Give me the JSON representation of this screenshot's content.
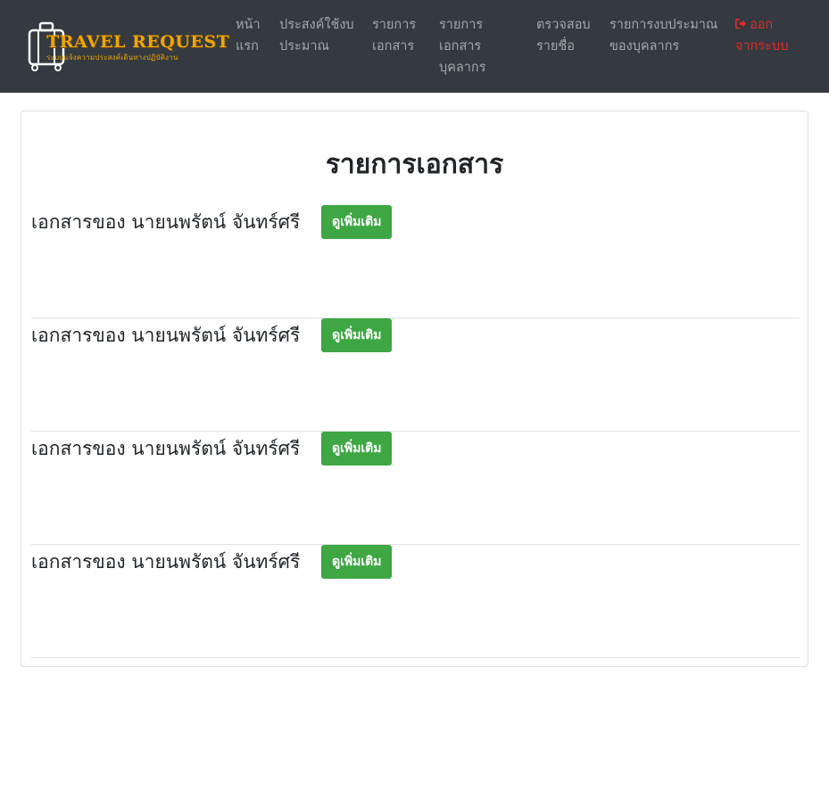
{
  "brand": {
    "title": "TRAVEL REQUEST",
    "subtitle": "ระบบแจ้งความประสงค์เดินทางปฏิบัติงาน",
    "logo_icon": "suitcase-icon",
    "color": "#f0a500"
  },
  "nav": {
    "items": [
      {
        "line1": "หน้า",
        "line2": "แรก",
        "line3": ""
      },
      {
        "line1": "ประสงค์ใช้งบ",
        "line2": "ประมาณ",
        "line3": ""
      },
      {
        "line1": "รายการ",
        "line2": "เอกสาร",
        "line3": ""
      },
      {
        "line1": "รายการ",
        "line2": "เอกสาร",
        "line3": "บุคลากร"
      },
      {
        "line1": "ตรวจสอบ",
        "line2": "รายชื่อ",
        "line3": ""
      },
      {
        "line1": "รายการงบประมาณ",
        "line2": "ของบุคลากร",
        "line3": ""
      }
    ],
    "logout": {
      "line1": "ออก",
      "line2": "จากระบบ",
      "icon": "sign-out-icon",
      "color": "#e32b2b"
    }
  },
  "main": {
    "title": "รายการเอกสาร",
    "documents": [
      {
        "label": "เอกสารของ นายนพรัตน์ จันทร์ศรี",
        "button": "ดูเพิ่มเติม"
      },
      {
        "label": "เอกสารของ นายนพรัตน์ จันทร์ศรี",
        "button": "ดูเพิ่มเติม"
      },
      {
        "label": "เอกสารของ นายนพรัตน์ จันทร์ศรี",
        "button": "ดูเพิ่มเติม"
      },
      {
        "label": "เอกสารของ นายนพรัตน์ จันทร์ศรี",
        "button": "ดูเพิ่มเติม"
      }
    ],
    "button_color": "#3ea743"
  }
}
